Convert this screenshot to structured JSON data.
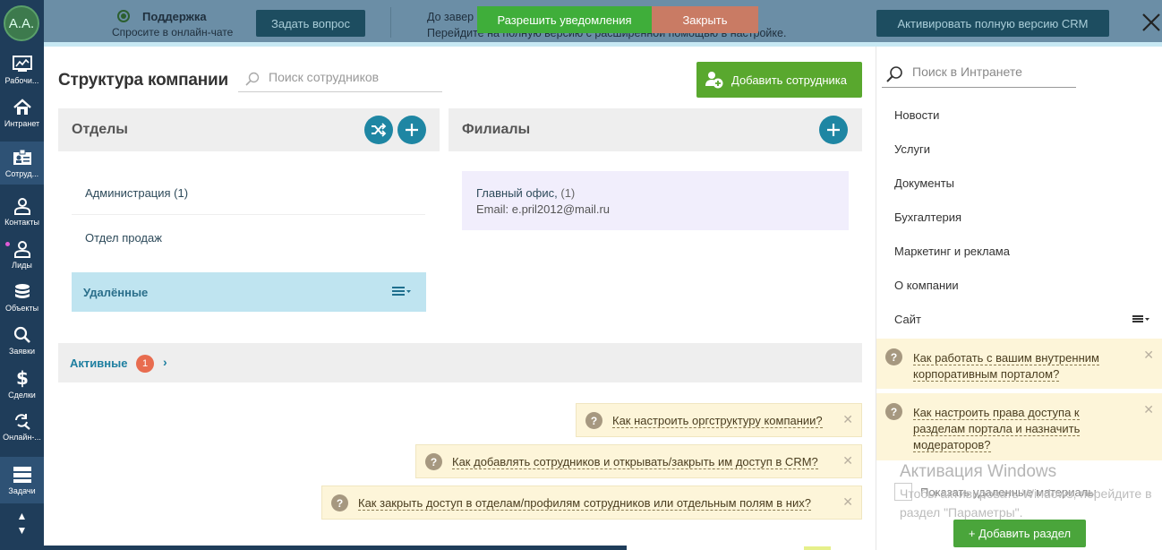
{
  "sidebar": {
    "avatar": "A.A.",
    "items": [
      {
        "label": "Рабочий стол",
        "short": "Рабочи..."
      },
      {
        "label": "Интранет"
      },
      {
        "label": "Сотрудники",
        "short": "Сотруд..."
      },
      {
        "label": "Контакты"
      },
      {
        "label": "Лиды"
      },
      {
        "label": "Объекты"
      },
      {
        "label": "Заявки"
      },
      {
        "label": "Сделки"
      },
      {
        "label": "Онлайн-...",
        "short": "Онлайн-..."
      },
      {
        "label": "Задачи"
      }
    ]
  },
  "topbar": {
    "support_title": "Поддержка",
    "support_sub": "Спросите в онлайн-чате",
    "ask_button": "Задать вопрос",
    "message_line1": "До завер",
    "message_line2": "Перейдите на полную версию с расширенной помощью в настройке.",
    "allow_notifications": "Разрешить уведомления",
    "close": "Закрыть",
    "activate_crm": "Активировать полную версию CRM"
  },
  "main": {
    "title": "Структура компании",
    "search_placeholder": "Поиск сотрудников",
    "add_employee": "Добавить сотрудника",
    "departments": {
      "title": "Отделы",
      "items": [
        "Администрация (1)",
        "Отдел продаж"
      ],
      "deleted": "Удалённые"
    },
    "branches": {
      "title": "Филиалы",
      "items": [
        {
          "name": "Главный офис,",
          "count": "(1)",
          "email": "Email: e.pril2012@mail.ru"
        }
      ]
    },
    "active": {
      "label": "Активные",
      "count": "1"
    },
    "hints": [
      "Как настроить оргструктуру компании?",
      "Как добавлять сотрудников и открывать/закрыть им доступ в CRM?",
      "Как закрыть доступ в отделам/профилям сотрудников или отдельным полям в них?"
    ]
  },
  "right": {
    "search_placeholder": "Поиск в Интранете",
    "menu": [
      "Новости",
      "Услуги",
      "Документы",
      "Бухгалтерия",
      "Маркетинг и реклама",
      "О компании",
      "Сайт"
    ],
    "hints": [
      "Как работать с вашим внутренним корпоративным порталом?",
      "Как настроить права доступа к разделам портала и назначить модераторов?"
    ],
    "windows_title": "Активация Windows",
    "windows_text": "Чтобы активировать Windows, перейдите в раздел \"Параметры\".",
    "show_deleted": "Показать удаленные материалы",
    "add_section": "+ Добавить раздел"
  }
}
